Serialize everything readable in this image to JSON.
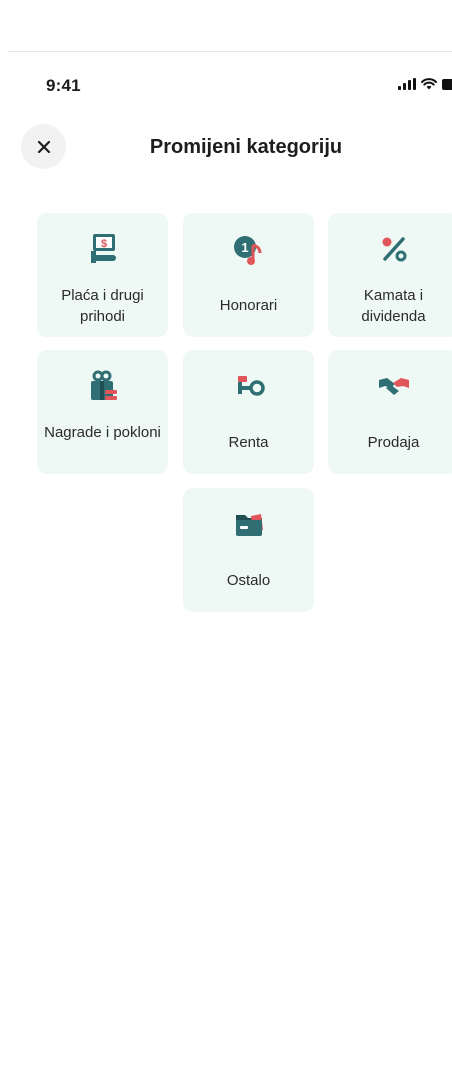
{
  "status_bar": {
    "time": "9:41"
  },
  "header": {
    "title": "Promijeni kategoriju"
  },
  "categories": [
    {
      "label": "Plaća i drugi prihodi",
      "icon": "salary-icon"
    },
    {
      "label": "Honorari",
      "icon": "honorarium-icon"
    },
    {
      "label": "Kamata i dividenda",
      "icon": "percent-icon"
    },
    {
      "label": "Nagrade i pokloni",
      "icon": "gift-icon"
    },
    {
      "label": "Renta",
      "icon": "key-icon"
    },
    {
      "label": "Prodaja",
      "icon": "handshake-icon"
    },
    {
      "label": "Ostalo",
      "icon": "folder-icon"
    }
  ],
  "colors": {
    "tile_background": "#eef8f4",
    "icon_teal": "#2f6f73",
    "icon_accent": "#e0555a"
  }
}
